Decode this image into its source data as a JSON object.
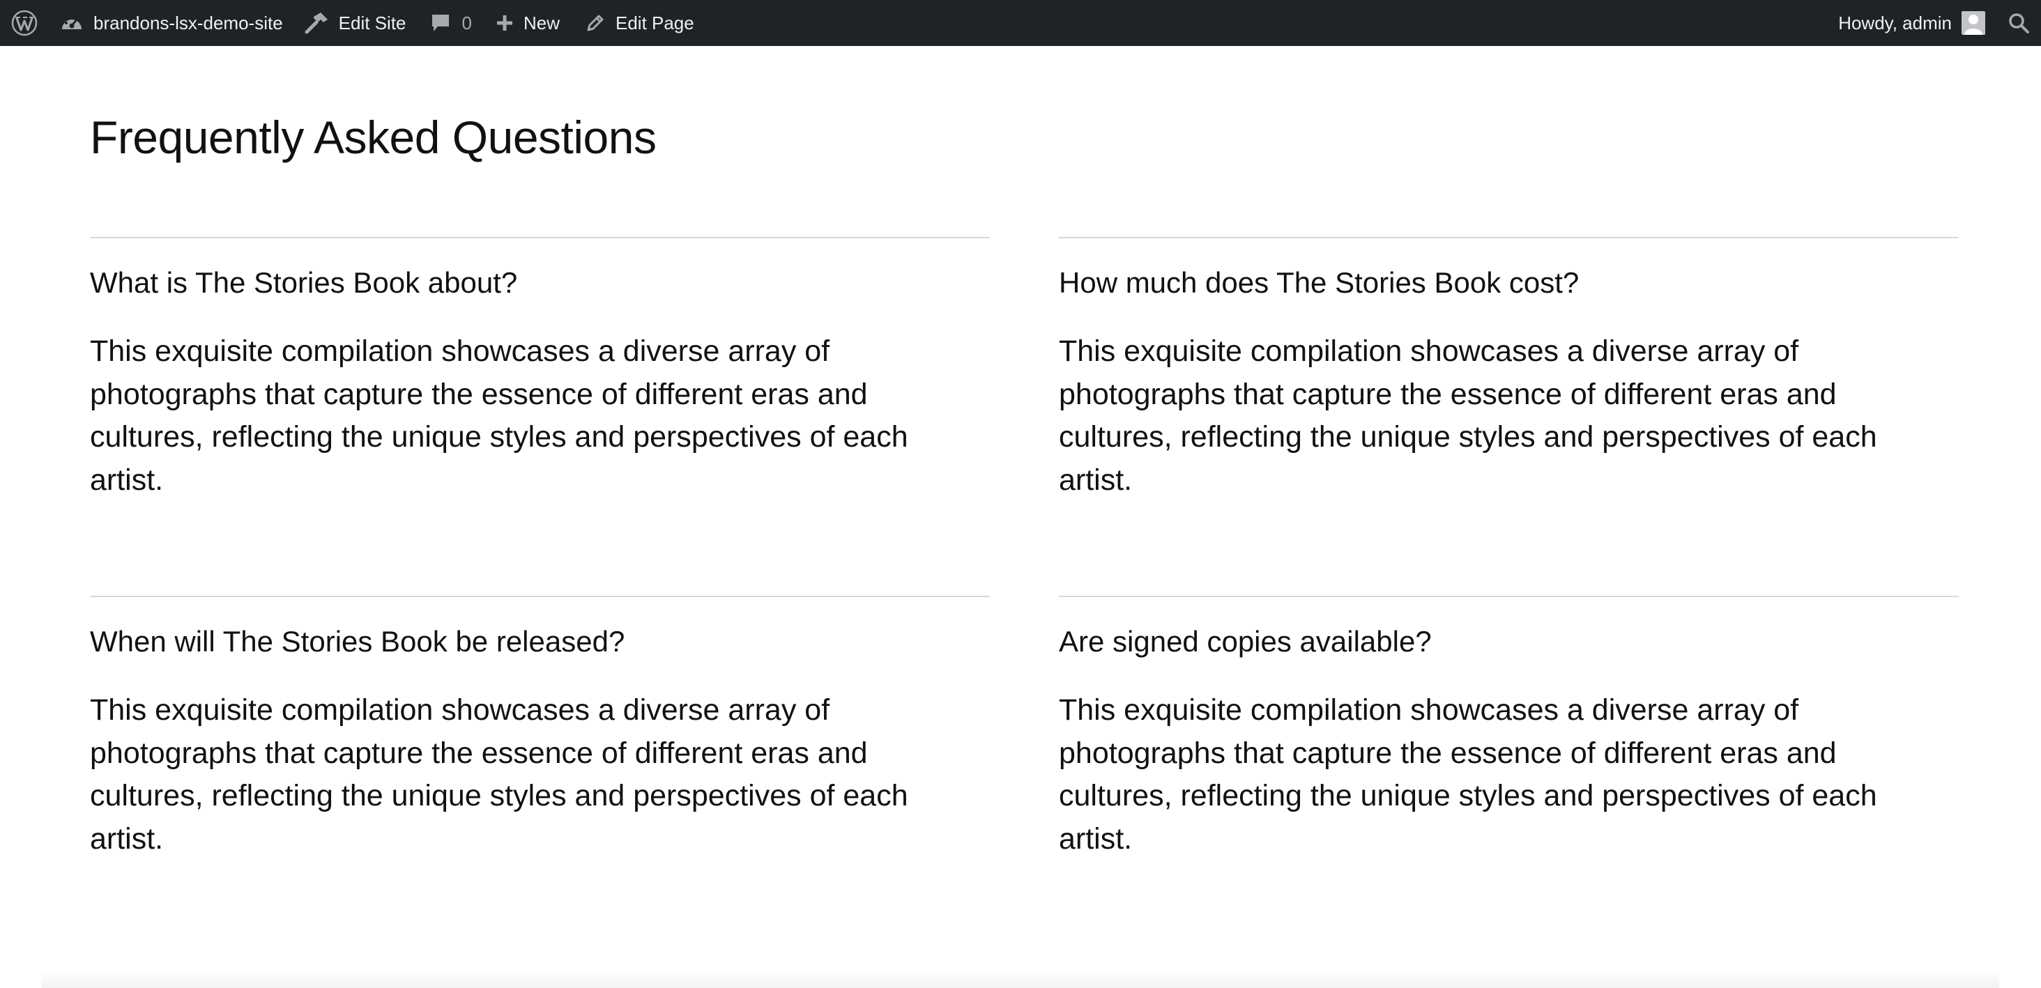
{
  "adminbar": {
    "site_name": "brandons-lsx-demo-site",
    "edit_site": "Edit Site",
    "comments_count": "0",
    "new_label": "New",
    "edit_page": "Edit Page",
    "howdy": "Howdy, admin",
    "colors": {
      "background": "#1d2327",
      "text": "#f0f0f1"
    }
  },
  "page": {
    "title": "Frequently Asked Questions",
    "faqs": [
      {
        "question": "What is The Stories Book about?",
        "answer": "This exquisite compilation showcases a diverse array of photographs that capture the essence of different eras and cultures, reflecting the unique styles and perspectives of each artist."
      },
      {
        "question": "How much does The Stories Book cost?",
        "answer": "This exquisite compilation showcases a diverse array of photographs that capture the essence of different eras and cultures, reflecting the unique styles and perspectives of each artist."
      },
      {
        "question": "When will The Stories Book be released?",
        "answer": "This exquisite compilation showcases a diverse array of photographs that capture the essence of different eras and cultures, reflecting the unique styles and perspectives of each artist."
      },
      {
        "question": "Are signed copies available?",
        "answer": "This exquisite compilation showcases a diverse array of photographs that capture the essence of different eras and cultures, reflecting the unique styles and perspectives of each artist."
      }
    ]
  }
}
